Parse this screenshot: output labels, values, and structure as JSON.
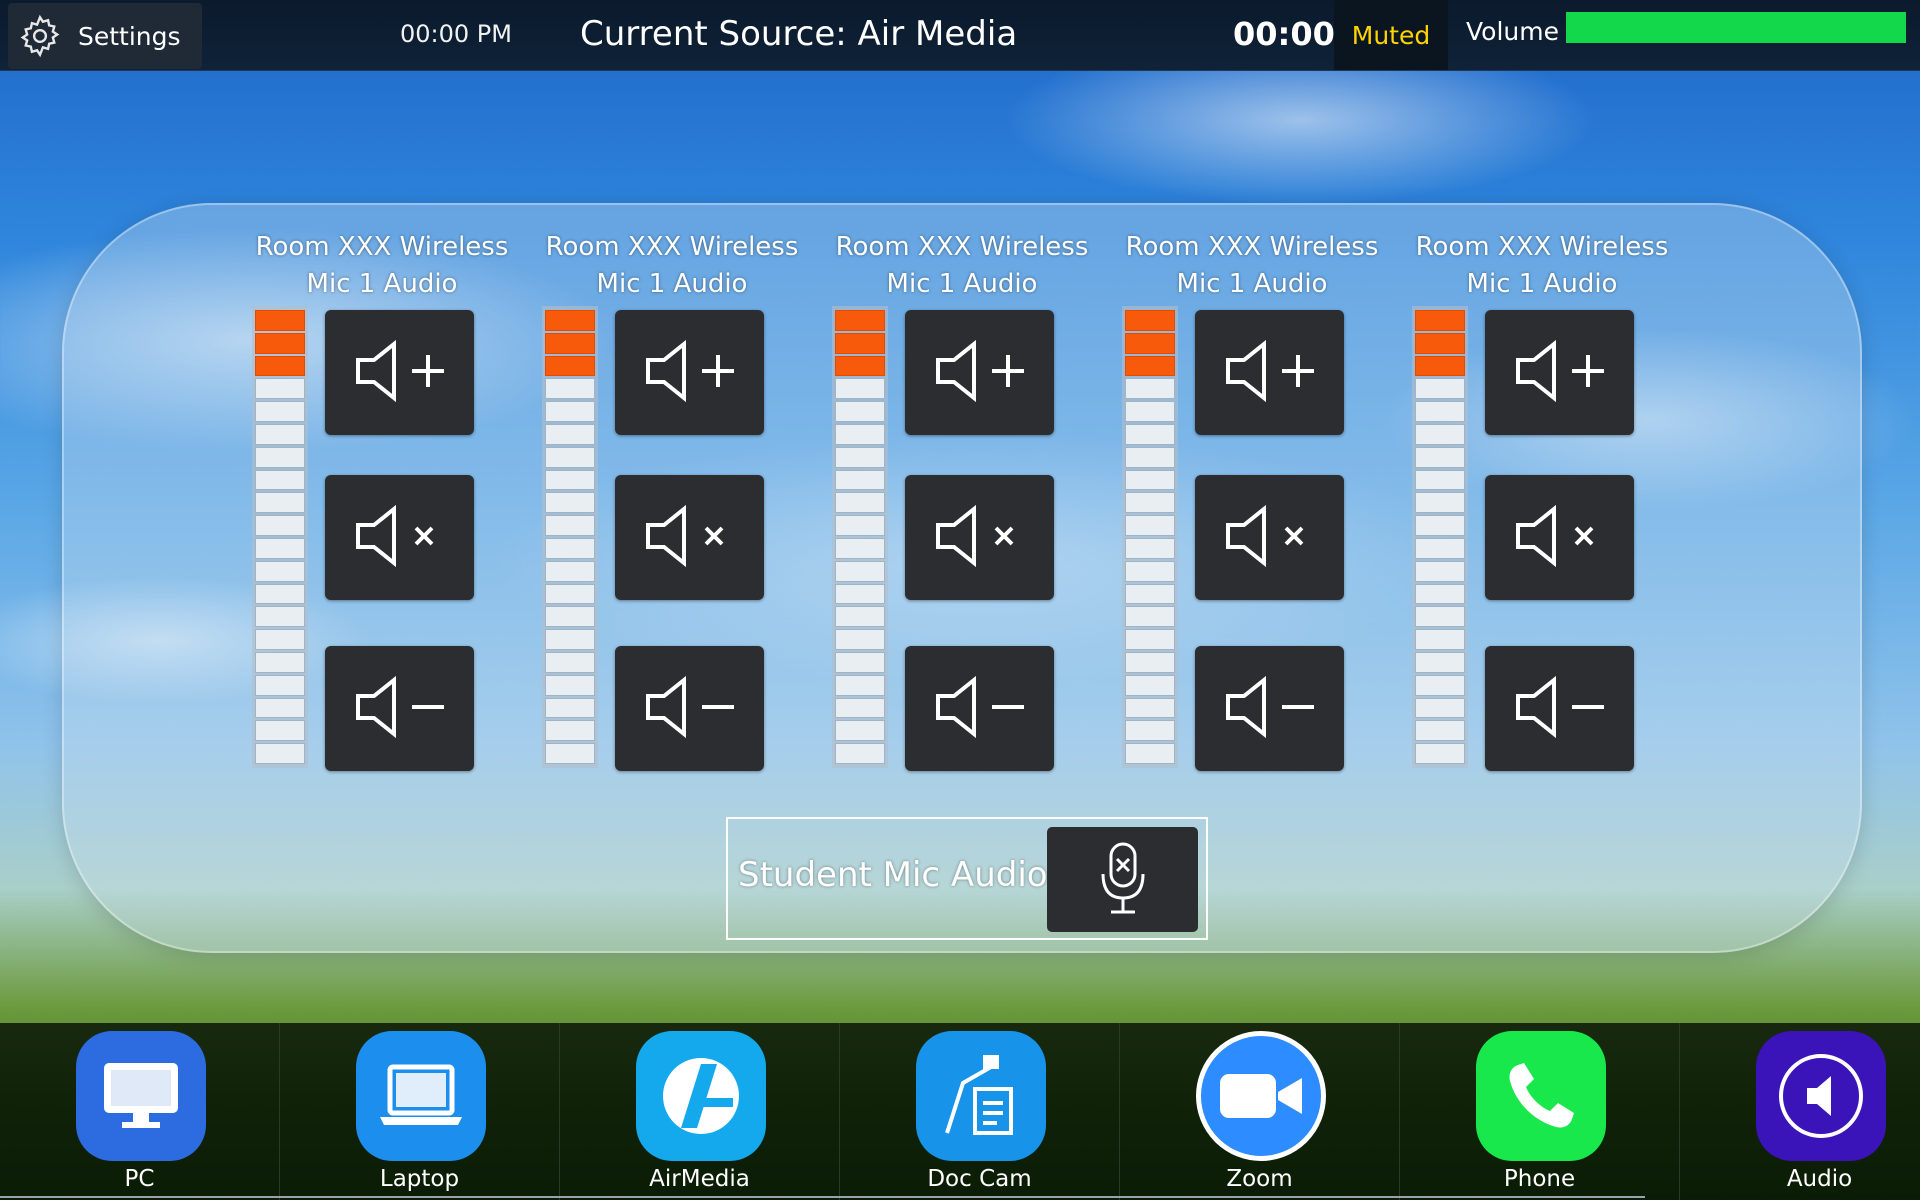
{
  "topbar": {
    "settings_label": "Settings",
    "clock": "00:00 PM",
    "current_source": "Current Source: Air Media",
    "timer": "00:00",
    "muted_label": "Muted",
    "volume_label": "Volume",
    "volume_level": 1.0,
    "volume_color": "#14d84c"
  },
  "channels": [
    {
      "title_line1": "Room XXX Wireless",
      "title_line2": "Mic 1 Audio",
      "meter_level": 3,
      "meter_segments": 20
    },
    {
      "title_line1": "Room XXX Wireless",
      "title_line2": "Mic 1 Audio",
      "meter_level": 3,
      "meter_segments": 20
    },
    {
      "title_line1": "Room XXX Wireless",
      "title_line2": "Mic 1 Audio",
      "meter_level": 3,
      "meter_segments": 20
    },
    {
      "title_line1": "Room XXX Wireless",
      "title_line2": "Mic 1 Audio",
      "meter_level": 3,
      "meter_segments": 20
    },
    {
      "title_line1": "Room XXX Wireless",
      "title_line2": "Mic 1 Audio",
      "meter_level": 3,
      "meter_segments": 20
    }
  ],
  "controls": {
    "volume_up_icon": "volume-up-icon",
    "mute_icon": "volume-mute-icon",
    "volume_down_icon": "volume-down-icon",
    "meter_on_color": "#f85a0c"
  },
  "student_mic": {
    "label": "Student Mic Audio",
    "icon": "mic-muted-icon"
  },
  "sources": [
    {
      "label": "PC",
      "icon": "monitor-icon",
      "color": "#2d6be0"
    },
    {
      "label": "Laptop",
      "icon": "laptop-icon",
      "color": "#1c8fee"
    },
    {
      "label": "AirMedia",
      "icon": "airmedia-icon",
      "color": "#14a8ec"
    },
    {
      "label": "Doc Cam",
      "icon": "document-camera-icon",
      "color": "#1793ea"
    },
    {
      "label": "Zoom",
      "icon": "video-camera-icon",
      "color": "#2d8cff"
    },
    {
      "label": "Phone",
      "icon": "phone-icon",
      "color": "#19e84d"
    },
    {
      "label": "Audio",
      "icon": "speaker-icon",
      "color": "#3a14b8"
    }
  ]
}
